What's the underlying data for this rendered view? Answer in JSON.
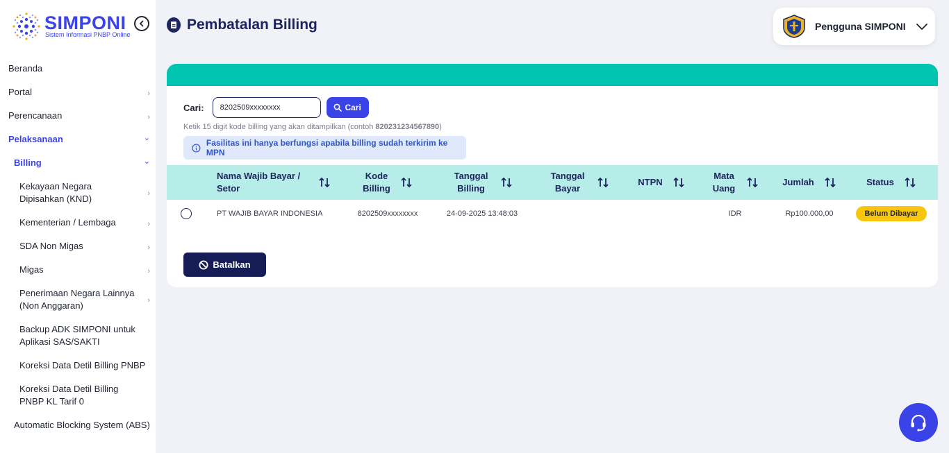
{
  "brand": {
    "title": "SIMPONI",
    "subtitle": "Sistem Informasi PNBP Online"
  },
  "sidebar": {
    "items": [
      {
        "label": "Beranda",
        "chevron": ""
      },
      {
        "label": "Portal",
        "chevron": "›"
      },
      {
        "label": "Perencanaan",
        "chevron": "›"
      },
      {
        "label": "Pelaksanaan",
        "chevron": "⌄"
      },
      {
        "label": "Billing",
        "chevron": "⌄"
      },
      {
        "label": "Kekayaan Negara Dipisahkan (KND)",
        "chevron": "›"
      },
      {
        "label": "Kementerian / Lembaga",
        "chevron": "›"
      },
      {
        "label": "SDA Non Migas",
        "chevron": "›"
      },
      {
        "label": "Migas",
        "chevron": "›"
      },
      {
        "label": "Penerimaan Negara Lainnya (Non Anggaran)",
        "chevron": "›"
      },
      {
        "label": "Backup ADK SIMPONI untuk Aplikasi SAS/SAKTI",
        "chevron": ""
      },
      {
        "label": "Koreksi Data Detil Billing PNBP",
        "chevron": ""
      },
      {
        "label": "Koreksi Data Detil Billing PNBP KL Tarif 0",
        "chevron": ""
      },
      {
        "label": "Automatic Blocking System (ABS)",
        "chevron": "›"
      }
    ]
  },
  "header": {
    "title": "Pembatalan Billing",
    "user_name": "Pengguna SIMPONI"
  },
  "search": {
    "label": "Cari:",
    "value": "8202509xxxxxxxx",
    "button_label": "Cari",
    "hint_prefix": "Ketik 15 digit kode billing yang akan ditampilkan (contoh ",
    "hint_example": "820231234567890",
    "hint_suffix": ")",
    "info": "Fasilitas ini hanya berfungsi apabila billing sudah terkirim ke MPN"
  },
  "table": {
    "columns": [
      "Nama Wajib Bayar / Setor",
      "Kode Billing",
      "Tanggal Billing",
      "Tanggal Bayar",
      "NTPN",
      "Mata Uang",
      "Jumlah",
      "Status"
    ],
    "rows": [
      {
        "nama": "PT WAJIB BAYAR INDONESIA",
        "kode": "8202509xxxxxxxx",
        "tanggal_billing": "24-09-2025 13:48:03",
        "tanggal_bayar": "",
        "ntpn": "",
        "mata_uang": "IDR",
        "jumlah": "Rp100.000,00",
        "status": "Belum Dibayar"
      }
    ]
  },
  "actions": {
    "cancel_label": "Batalkan"
  },
  "colors": {
    "primary": "#3a43e8",
    "navy": "#1e2460",
    "teal": "#00c4b0",
    "table_header": "#b7ede8",
    "status_badge": "#f8c60d"
  },
  "icons": [
    "collapse-left-icon",
    "document-icon",
    "user-logo",
    "chevron-down-icon",
    "search-icon",
    "info-icon",
    "sort-icon",
    "ban-icon",
    "headset-icon"
  ]
}
